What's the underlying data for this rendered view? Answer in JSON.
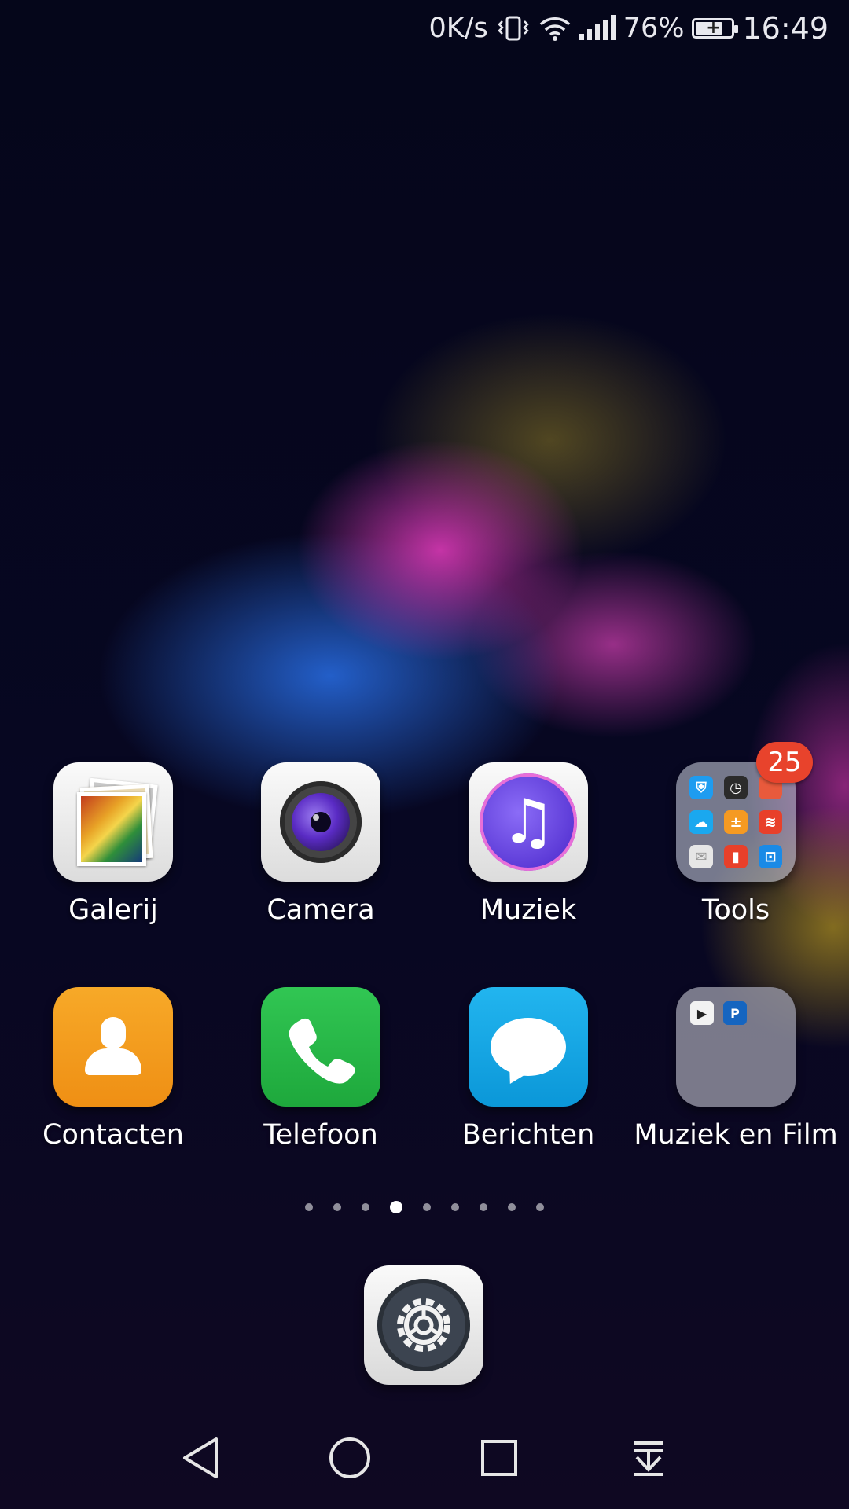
{
  "status_bar": {
    "net_speed": "0K/s",
    "battery_percent": "76%",
    "time": "16:49",
    "icons": [
      "vibrate-icon",
      "wifi-icon",
      "signal-icon",
      "battery-charging-icon"
    ]
  },
  "apps": {
    "row1": [
      {
        "label": "Galerij",
        "icon": "gallery-icon"
      },
      {
        "label": "Camera",
        "icon": "camera-icon"
      },
      {
        "label": "Muziek",
        "icon": "music-icon"
      },
      {
        "label": "Tools",
        "icon": "tools-folder-icon",
        "badge": "25"
      }
    ],
    "row2": [
      {
        "label": "Contacten",
        "icon": "contacts-icon"
      },
      {
        "label": "Telefoon",
        "icon": "phone-icon"
      },
      {
        "label": "Berichten",
        "icon": "messages-icon"
      },
      {
        "label": "Muziek en Film",
        "icon": "media-folder-icon"
      }
    ]
  },
  "page_indicator": {
    "total": 9,
    "active_index": 3
  },
  "dock": {
    "icon": "settings-icon"
  },
  "nav_bar": {
    "buttons": [
      "back-icon",
      "home-icon",
      "recents-icon",
      "notification-pulldown-icon"
    ]
  },
  "folder_contents": {
    "media_mini_label": "P"
  },
  "colors": {
    "badge": "#e8432c",
    "contacts": "#f7a928",
    "phone": "#31c653",
    "messages": "#22b5ef"
  }
}
